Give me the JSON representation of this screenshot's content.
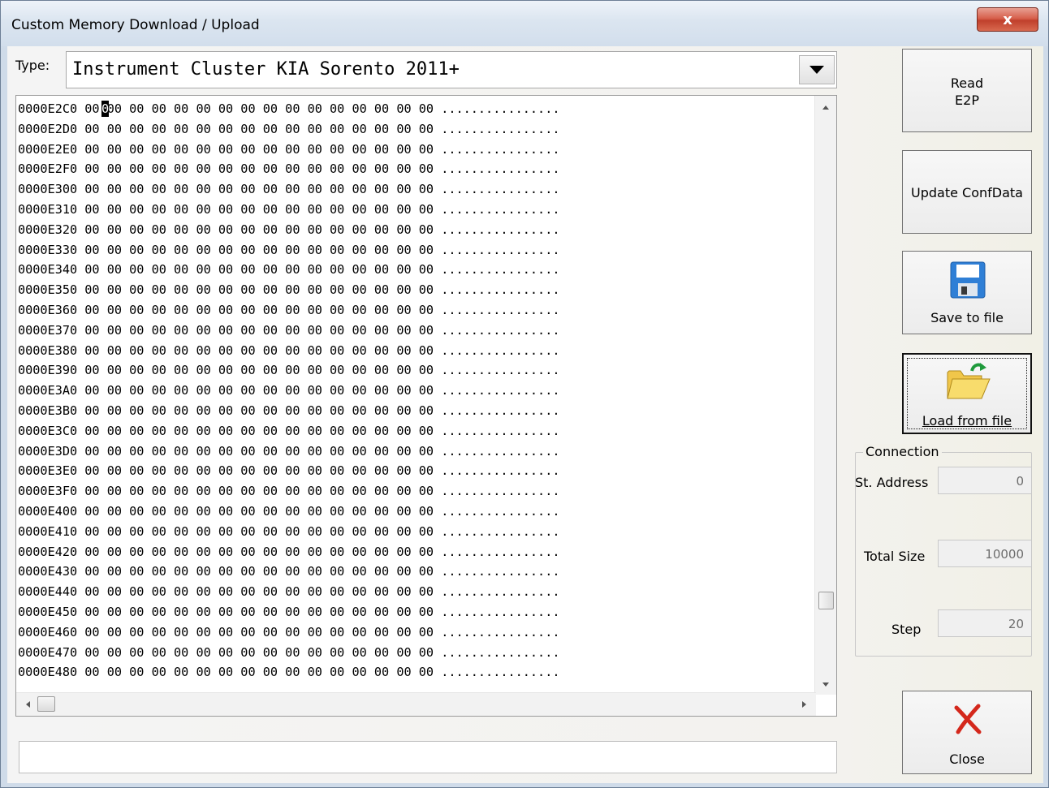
{
  "window": {
    "title": "Custom Memory Download / Upload",
    "close_glyph": "x"
  },
  "type_selector": {
    "label": "Type:",
    "value": "Instrument Cluster KIA Sorento 2011+"
  },
  "hex_view": {
    "rows": [
      "0000E2C0 00 00 00 00 00 00 00 00 00 00 00 00 00 00 00 00 ................",
      "0000E2D0 00 00 00 00 00 00 00 00 00 00 00 00 00 00 00 00 ................",
      "0000E2E0 00 00 00 00 00 00 00 00 00 00 00 00 00 00 00 00 ................",
      "0000E2F0 00 00 00 00 00 00 00 00 00 00 00 00 00 00 00 00 ................",
      "0000E300 00 00 00 00 00 00 00 00 00 00 00 00 00 00 00 00 ................",
      "0000E310 00 00 00 00 00 00 00 00 00 00 00 00 00 00 00 00 ................",
      "0000E320 00 00 00 00 00 00 00 00 00 00 00 00 00 00 00 00 ................",
      "0000E330 00 00 00 00 00 00 00 00 00 00 00 00 00 00 00 00 ................",
      "0000E340 00 00 00 00 00 00 00 00 00 00 00 00 00 00 00 00 ................",
      "0000E350 00 00 00 00 00 00 00 00 00 00 00 00 00 00 00 00 ................",
      "0000E360 00 00 00 00 00 00 00 00 00 00 00 00 00 00 00 00 ................",
      "0000E370 00 00 00 00 00 00 00 00 00 00 00 00 00 00 00 00 ................",
      "0000E380 00 00 00 00 00 00 00 00 00 00 00 00 00 00 00 00 ................",
      "0000E390 00 00 00 00 00 00 00 00 00 00 00 00 00 00 00 00 ................",
      "0000E3A0 00 00 00 00 00 00 00 00 00 00 00 00 00 00 00 00 ................",
      "0000E3B0 00 00 00 00 00 00 00 00 00 00 00 00 00 00 00 00 ................",
      "0000E3C0 00 00 00 00 00 00 00 00 00 00 00 00 00 00 00 00 ................",
      "0000E3D0 00 00 00 00 00 00 00 00 00 00 00 00 00 00 00 00 ................",
      "0000E3E0 00 00 00 00 00 00 00 00 00 00 00 00 00 00 00 00 ................",
      "0000E3F0 00 00 00 00 00 00 00 00 00 00 00 00 00 00 00 00 ................",
      "0000E400 00 00 00 00 00 00 00 00 00 00 00 00 00 00 00 00 ................",
      "0000E410 00 00 00 00 00 00 00 00 00 00 00 00 00 00 00 00 ................",
      "0000E420 00 00 00 00 00 00 00 00 00 00 00 00 00 00 00 00 ................",
      "0000E430 00 00 00 00 00 00 00 00 00 00 00 00 00 00 00 00 ................",
      "0000E440 00 00 00 00 00 00 00 00 00 00 00 00 00 00 00 00 ................",
      "0000E450 00 00 00 00 00 00 00 00 00 00 00 00 00 00 00 00 ................",
      "0000E460 00 00 00 00 00 00 00 00 00 00 00 00 00 00 00 00 ................",
      "0000E470 00 00 00 00 00 00 00 00 00 00 00 00 00 00 00 00 ................",
      "0000E480 00 00 00 00 00 00 00 00 00 00 00 00 00 00 00 00 ................"
    ],
    "cursor_char": "0"
  },
  "buttons": {
    "read_line1": "Read",
    "read_line2": "E2P",
    "update": "Update ConfData",
    "save": "Save to file",
    "load": "Load from file",
    "close": "Close"
  },
  "connection": {
    "title": "Connection",
    "start_address_label": "St. Address",
    "start_address_value": "0",
    "total_size_label": "Total Size",
    "total_size_value": "10000",
    "step_label": "Step",
    "step_value": "20"
  },
  "status_bar": {
    "text": ""
  },
  "icons": {
    "save": "floppy-disk-icon",
    "load": "open-folder-icon",
    "close": "red-x-icon"
  },
  "colors": {
    "close_title_button": "#d7604c",
    "floppy_blue": "#2f7fd6",
    "folder_yellow": "#f5d35a",
    "close_x_red": "#d4281c"
  }
}
